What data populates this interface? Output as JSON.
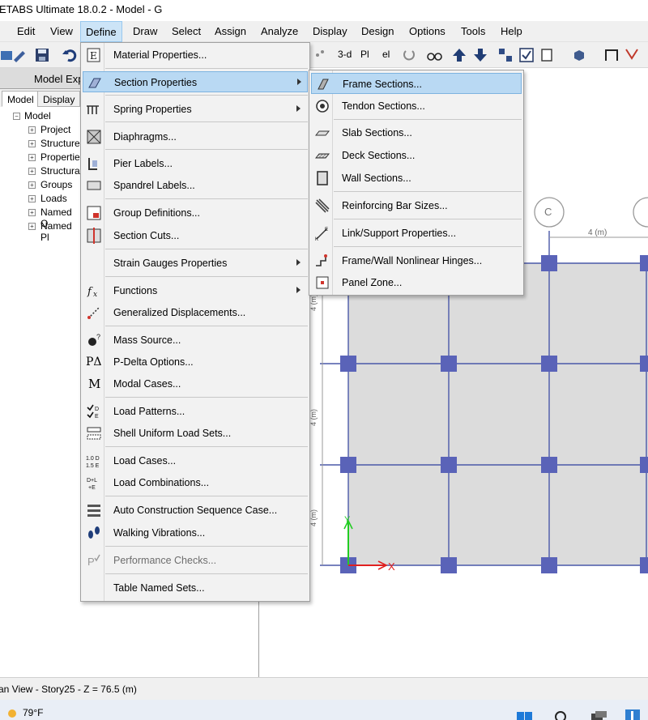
{
  "window": {
    "title": "ETABS Ultimate 18.0.2 - Model - G"
  },
  "menubar": {
    "items": [
      "Edit",
      "View",
      "Define",
      "Draw",
      "Select",
      "Assign",
      "Analyze",
      "Display",
      "Design",
      "Options",
      "Tools",
      "Help"
    ],
    "active": "Define"
  },
  "toolbar": {
    "view_3d": "3-d",
    "plan": "Pl",
    "elev": "el"
  },
  "explorer": {
    "title": "Model Exp",
    "tabs": [
      "Model",
      "Display"
    ],
    "root": "Model",
    "nodes": [
      "Project",
      "Structure",
      "Properties",
      "Structural",
      "Groups",
      "Loads",
      "Named O",
      "Named Pl"
    ]
  },
  "define_menu": {
    "items": [
      {
        "label": "Material Properties...",
        "icon": "material-icon"
      },
      {
        "label": "Section Properties",
        "icon": "section-icon",
        "submenu": true
      },
      {
        "label": "Spring Properties",
        "icon": "spring-icon",
        "submenu": true
      },
      {
        "label": "Diaphragms...",
        "icon": "diaphragm-icon"
      },
      {
        "label": "Pier Labels...",
        "icon": "pier-icon"
      },
      {
        "label": "Spandrel Labels...",
        "icon": "spandrel-icon"
      },
      {
        "label": "Group Definitions...",
        "icon": "group-icon"
      },
      {
        "label": "Section Cuts...",
        "icon": "section-cut-icon"
      },
      {
        "label": "Strain Gauges Properties",
        "icon": "",
        "submenu": true
      },
      {
        "label": "Functions",
        "icon": "function-icon",
        "submenu": true
      },
      {
        "label": "Generalized Displacements...",
        "icon": "displacement-icon"
      },
      {
        "label": "Mass Source...",
        "icon": "mass-icon"
      },
      {
        "label": "P-Delta Options...",
        "icon": "pdelta-icon",
        "icon_text": "PΔ"
      },
      {
        "label": "Modal Cases...",
        "icon": "modal-icon",
        "icon_text": "M"
      },
      {
        "label": "Load Patterns...",
        "icon": "load-pattern-icon"
      },
      {
        "label": "Shell Uniform Load Sets...",
        "icon": "shell-load-icon"
      },
      {
        "label": "Load Cases...",
        "icon": "load-case-icon"
      },
      {
        "label": "Load Combinations...",
        "icon": "load-combo-icon"
      },
      {
        "label": "Auto Construction Sequence Case...",
        "icon": "construction-icon"
      },
      {
        "label": "Walking Vibrations...",
        "icon": "footsteps-icon"
      },
      {
        "label": "Performance Checks...",
        "icon": "performance-icon",
        "disabled": true
      },
      {
        "label": "Table Named Sets...",
        "icon": ""
      }
    ]
  },
  "section_submenu": {
    "items": [
      {
        "label": "Frame Sections...",
        "icon": "frame-section-icon"
      },
      {
        "label": "Tendon Sections...",
        "icon": "tendon-icon"
      },
      {
        "label": "Slab Sections...",
        "icon": "slab-icon"
      },
      {
        "label": "Deck Sections...",
        "icon": "deck-icon"
      },
      {
        "label": "Wall Sections...",
        "icon": "wall-icon"
      },
      {
        "label": "Reinforcing Bar Sizes...",
        "icon": "rebar-icon"
      },
      {
        "label": "Link/Support Properties...",
        "icon": "link-icon"
      },
      {
        "label": "Frame/Wall Nonlinear Hinges...",
        "icon": "hinge-icon"
      },
      {
        "label": "Panel Zone...",
        "icon": "panel-zone-icon"
      }
    ]
  },
  "plan": {
    "grid_bubble": "C",
    "dim_top": "4 (m)",
    "dim_side": [
      "4 (m)",
      "4 (m)",
      "4 (m)"
    ],
    "axis_y": "Y",
    "axis_x": "X"
  },
  "status": {
    "text": "an View - Story25 - Z = 76.5 (m)"
  },
  "taskbar": {
    "temperature": "79°F"
  },
  "colors": {
    "highlight": "#b9d9f3",
    "column": "#5a63b8",
    "slab": "#dcdcdc",
    "grid": "#4a58a8"
  }
}
